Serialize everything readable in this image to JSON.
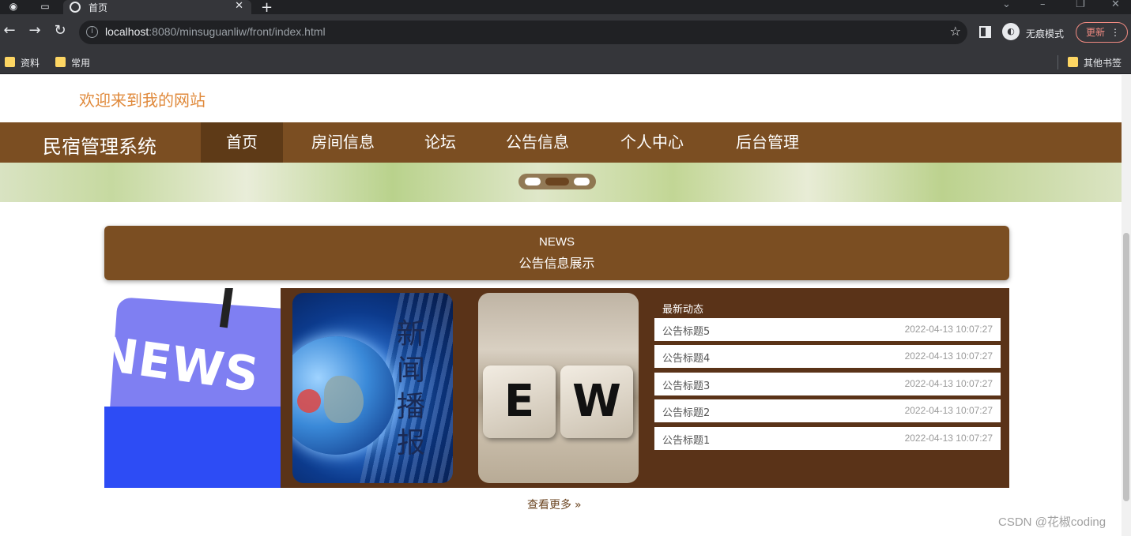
{
  "browser": {
    "tab_title": "首页",
    "url_host": "localhost",
    "url_rest": ":8080/minsuguanliw/front/index.html",
    "incognito_label": "无痕模式",
    "update_label": "更新",
    "bookmarks": [
      "资料",
      "常用"
    ],
    "other_bookmarks": "其他书签"
  },
  "site": {
    "welcome": "欢迎来到我的网站",
    "brand": "民宿管理系统",
    "nav": [
      "首页",
      "房间信息",
      "论坛",
      "公告信息",
      "个人中心",
      "后台管理"
    ],
    "active_nav_index": 0
  },
  "carousel": {
    "slide_count": 3,
    "active_index": 1
  },
  "news": {
    "header_en": "NEWS",
    "header_cn": "公告信息展示",
    "image_texts": {
      "news_tile": "NEWS",
      "globe_caption": "新闻播报",
      "cubes": [
        "E",
        "W"
      ]
    },
    "latest_title": "最新动态",
    "items": [
      {
        "title": "公告标题5",
        "date": "2022-04-13 10:07:27"
      },
      {
        "title": "公告标题4",
        "date": "2022-04-13 10:07:27"
      },
      {
        "title": "公告标题3",
        "date": "2022-04-13 10:07:27"
      },
      {
        "title": "公告标题2",
        "date": "2022-04-13 10:07:27"
      },
      {
        "title": "公告标题1",
        "date": "2022-04-13 10:07:27"
      }
    ],
    "more_label": "查看更多",
    "more_icon": "double-chevron-right-icon"
  },
  "watermark": "CSDN @花椒coding",
  "colors": {
    "nav_bg": "#7b4e22",
    "nav_active": "#5e3a17",
    "news_panel": "#5a3318",
    "welcome": "#e08a3c"
  }
}
